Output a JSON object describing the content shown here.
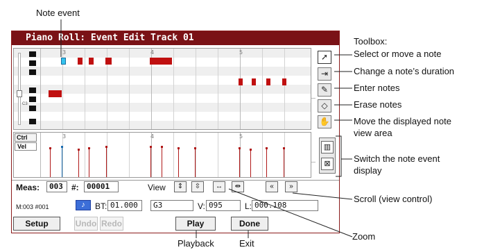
{
  "window": {
    "title": "Piano Roll: Event Edit Track 01"
  },
  "roll": {
    "bar_numbers": [
      "3",
      "4",
      "5"
    ],
    "c3_label": "C3"
  },
  "controller": {
    "ctrl_label": "Ctrl",
    "vel_label": "Vel"
  },
  "panel": {
    "meas_label": "Meas:",
    "meas_value": "003",
    "event_label": "#:",
    "event_value": "00001",
    "view_label": "View",
    "position_label": "M:003 #001",
    "bt_label": "BT:",
    "bt_value": "01.000",
    "pitch_value": "G3",
    "v_label": "V:",
    "v_value": "095",
    "l_label": "L:",
    "l_value": "000.108"
  },
  "buttons": {
    "setup": "Setup",
    "undo": "Undo",
    "redo": "Redo",
    "play": "Play",
    "done": "Done"
  },
  "callouts": {
    "note_event": "Note event",
    "toolbox_title": "Toolbox:",
    "select": "Select or move a note",
    "duration": "Change a note’s duration",
    "enter": "Enter notes",
    "erase": "Erase notes",
    "move_view_1": "Move the displayed note",
    "move_view_2": "view area",
    "switch_1": "Switch the note event",
    "switch_2": "display",
    "scroll": "Scroll (view control)",
    "zoom": "Zoom",
    "playback": "Playback",
    "exit": "Exit"
  },
  "icons": {
    "select": "arrow-cursor-icon",
    "duration": "duration-arrow-icon",
    "enter": "pencil-icon",
    "erase": "eraser-icon",
    "move": "hand-icon",
    "keyboard": "keyboard-icon",
    "drum": "drum-icon",
    "zoom_v_in": "zoom-vertical-in-icon",
    "zoom_v_out": "zoom-vertical-out-icon",
    "zoom_h_in": "zoom-horizontal-in-icon",
    "zoom_h_out": "zoom-horizontal-out-icon",
    "scroll_left": "scroll-left-icon",
    "scroll_right": "scroll-right-icon",
    "note": "note-icon"
  },
  "colors": {
    "title_bar": "#7a1216",
    "note": "#c01010",
    "selected_note": "#34c3ee",
    "note_button": "#3c6ed8"
  }
}
